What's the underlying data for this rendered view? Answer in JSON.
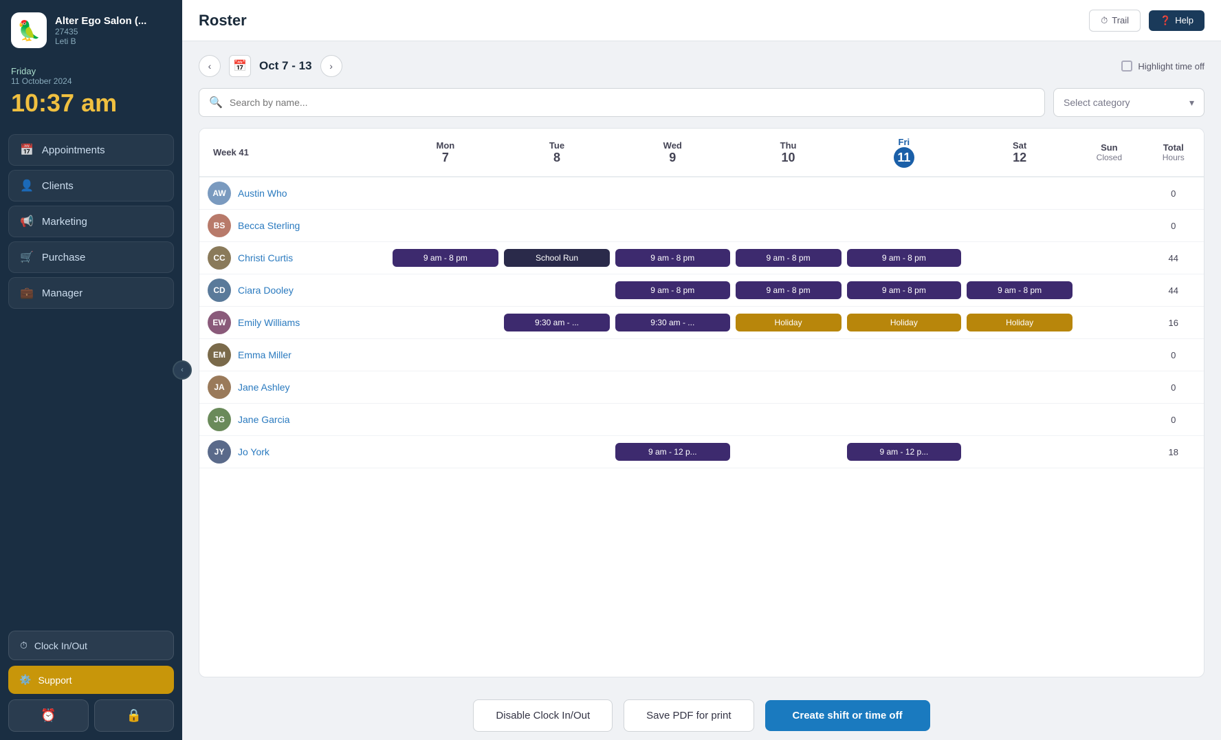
{
  "sidebar": {
    "logo_emoji": "🦜",
    "company_name": "Alter Ego Salon (...",
    "company_id": "27435",
    "user": "Leti B",
    "day": "Friday",
    "date": "11 October 2024",
    "time": "10:37 am",
    "nav_items": [
      {
        "id": "appointments",
        "label": "Appointments",
        "icon": "📅"
      },
      {
        "id": "clients",
        "label": "Clients",
        "icon": "👤"
      },
      {
        "id": "marketing",
        "label": "Marketing",
        "icon": "📢"
      },
      {
        "id": "purchase",
        "label": "Purchase",
        "icon": "🛒"
      },
      {
        "id": "manager",
        "label": "Manager",
        "icon": "💼"
      }
    ],
    "clock_label": "Clock In/Out",
    "support_label": "Support"
  },
  "topbar": {
    "title": "Roster",
    "trail_label": "Trail",
    "help_label": "Help"
  },
  "roster": {
    "prev_arrow": "‹",
    "cal_icon": "📅",
    "next_arrow": "›",
    "date_range": "Oct 7 - 13",
    "highlight_label": "Highlight time off",
    "search_placeholder": "Search by name...",
    "select_placeholder": "Select category",
    "week_label": "Week 41",
    "columns": [
      {
        "day": "Mon",
        "date": "7",
        "sub": ""
      },
      {
        "day": "Tue",
        "date": "8",
        "sub": ""
      },
      {
        "day": "Wed",
        "date": "9",
        "sub": ""
      },
      {
        "day": "Thu",
        "date": "10",
        "sub": ""
      },
      {
        "day": "Fri",
        "date": "11",
        "sub": "",
        "today": true
      },
      {
        "day": "Sat",
        "date": "12",
        "sub": ""
      },
      {
        "day": "Sun",
        "date": "Closed",
        "sub": ""
      },
      {
        "day": "Total",
        "date": "Hours",
        "sub": ""
      }
    ],
    "employees": [
      {
        "name": "Austin Who",
        "avatar_initials": "AW",
        "avatar_color": "#7a9abf",
        "shifts": {
          "mon": null,
          "tue": null,
          "wed": null,
          "thu": null,
          "fri": null,
          "sat": null,
          "sun": null
        },
        "total": "0"
      },
      {
        "name": "Becca Sterling",
        "avatar_initials": "BS",
        "avatar_color": "#b87a6a",
        "shifts": {
          "mon": null,
          "tue": null,
          "wed": null,
          "thu": null,
          "fri": null,
          "sat": null,
          "sun": null
        },
        "total": "0"
      },
      {
        "name": "Christi Curtis",
        "avatar_initials": "CC",
        "avatar_color": "#8a7a5a",
        "shifts": {
          "mon": {
            "label": "9 am - 8 pm",
            "type": "purple"
          },
          "tue": {
            "label": "School Run",
            "type": "dark"
          },
          "wed": {
            "label": "9 am - 8 pm",
            "type": "purple"
          },
          "thu": {
            "label": "9 am - 8 pm",
            "type": "purple"
          },
          "fri": {
            "label": "9 am - 8 pm",
            "type": "purple"
          },
          "sat": null,
          "sun": null
        },
        "total": "44"
      },
      {
        "name": "Ciara Dooley",
        "avatar_initials": "CD",
        "avatar_color": "#5a7a9a",
        "shifts": {
          "mon": null,
          "tue": null,
          "wed": {
            "label": "9 am - 8 pm",
            "type": "purple"
          },
          "thu": {
            "label": "9 am - 8 pm",
            "type": "purple"
          },
          "fri": {
            "label": "9 am - 8 pm",
            "type": "purple"
          },
          "sat": {
            "label": "9 am - 8 pm",
            "type": "purple"
          },
          "sun": null
        },
        "total": "44"
      },
      {
        "name": "Emily Williams",
        "avatar_initials": "EW",
        "avatar_color": "#8a5a7a",
        "shifts": {
          "mon": null,
          "tue": {
            "label": "9:30 am - ...",
            "type": "purple"
          },
          "wed": {
            "label": "9:30 am - ...",
            "type": "purple"
          },
          "thu": {
            "label": "Holiday",
            "type": "gold"
          },
          "fri": {
            "label": "Holiday",
            "type": "gold"
          },
          "sat": {
            "label": "Holiday",
            "type": "gold"
          },
          "sun": null
        },
        "total": "16"
      },
      {
        "name": "Emma Miller",
        "avatar_initials": "EM",
        "avatar_color": "#7a6a4a",
        "shifts": {
          "mon": null,
          "tue": null,
          "wed": null,
          "thu": null,
          "fri": null,
          "sat": null,
          "sun": null
        },
        "total": "0"
      },
      {
        "name": "Jane Ashley",
        "avatar_initials": "JA",
        "avatar_color": "#9a7a5a",
        "shifts": {
          "mon": null,
          "tue": null,
          "wed": null,
          "thu": null,
          "fri": null,
          "sat": null,
          "sun": null
        },
        "total": "0"
      },
      {
        "name": "Jane Garcia",
        "avatar_initials": "JG",
        "avatar_color": "#6a8a5a",
        "shifts": {
          "mon": null,
          "tue": null,
          "wed": null,
          "thu": null,
          "fri": null,
          "sat": null,
          "sun": null
        },
        "total": "0"
      },
      {
        "name": "Jo York",
        "avatar_initials": "JY",
        "avatar_color": "#5a6a8a",
        "shifts": {
          "mon": null,
          "tue": null,
          "wed": {
            "label": "9 am - 12 p...",
            "type": "purple"
          },
          "thu": null,
          "fri": {
            "label": "9 am - 12 p...",
            "type": "purple"
          },
          "sat": null,
          "sun": null
        },
        "total": "18"
      }
    ],
    "btn_disable": "Disable Clock In/Out",
    "btn_pdf": "Save PDF for print",
    "btn_create": "Create shift or time off"
  }
}
